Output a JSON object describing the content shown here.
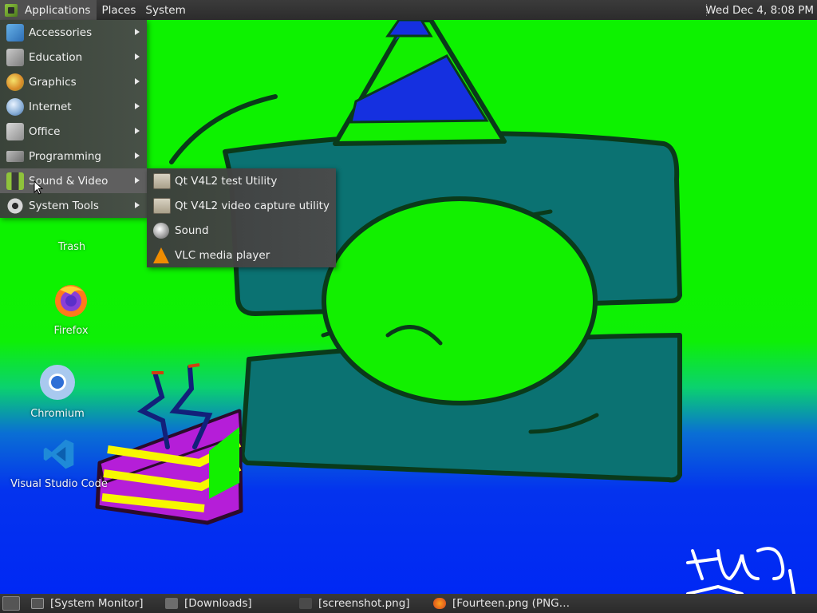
{
  "top_panel": {
    "menus": [
      "Applications",
      "Places",
      "System"
    ],
    "clock": "Wed Dec  4,  8:08 PM"
  },
  "app_menu": {
    "items": [
      {
        "label": "Accessories",
        "icon": "accessories-icon"
      },
      {
        "label": "Education",
        "icon": "education-icon"
      },
      {
        "label": "Graphics",
        "icon": "graphics-icon"
      },
      {
        "label": "Internet",
        "icon": "internet-icon"
      },
      {
        "label": "Office",
        "icon": "office-icon"
      },
      {
        "label": "Programming",
        "icon": "programming-icon"
      },
      {
        "label": "Sound & Video",
        "icon": "sound-video-icon",
        "active": true
      },
      {
        "label": "System Tools",
        "icon": "system-tools-icon"
      }
    ]
  },
  "submenu": {
    "items": [
      {
        "label": "Qt V4L2 test Utility",
        "icon": "qt-icon"
      },
      {
        "label": "Qt V4L2 video capture utility",
        "icon": "qt-icon"
      },
      {
        "label": "Sound",
        "icon": "sound-icon"
      },
      {
        "label": "VLC media player",
        "icon": "vlc-icon"
      }
    ]
  },
  "desktop_icons": {
    "trash": "Trash",
    "firefox": "Firefox",
    "chromium": "Chromium",
    "vscode": "Visual Studio Code"
  },
  "taskbar": {
    "tasks": [
      "[System Monitor]",
      "[Downloads]",
      "[screenshot.png]",
      "[Fourteen.png (PNG…"
    ]
  },
  "colors": {
    "panel": "#2f2f2f",
    "wallpaper_green": "#0df200",
    "wallpaper_blue": "#0028f4"
  }
}
